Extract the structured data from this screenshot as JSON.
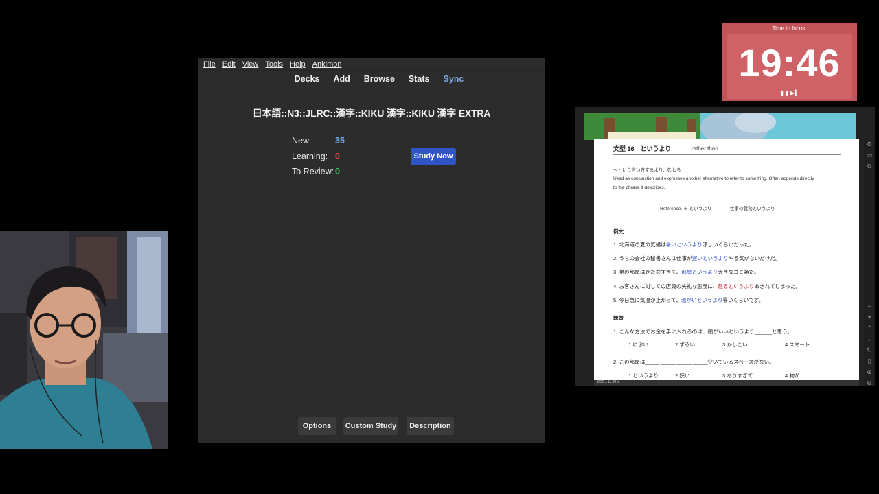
{
  "anki": {
    "menu": [
      "File",
      "Edit",
      "View",
      "Tools",
      "Help",
      "Ankimon"
    ],
    "toolbar": {
      "decks": "Decks",
      "add": "Add",
      "browse": "Browse",
      "stats": "Stats",
      "sync": "Sync"
    },
    "deck_title": "日本語::N3::JLRC::漢字::KIKU 漢字::KIKU 漢字 EXTRA",
    "stats": {
      "new_label": "New:",
      "new_value": "35",
      "learning_label": "Learning:",
      "learning_value": "0",
      "review_label": "To Review:",
      "review_value": "0"
    },
    "study_now": "Study Now",
    "buttons": {
      "options": "Options",
      "custom_study": "Custom Study",
      "description": "Description"
    },
    "colors": {
      "new": "#6fa8e8",
      "learning": "#e8484c",
      "review": "#3cc86a",
      "accent": "#2f54c6"
    }
  },
  "timer": {
    "label": "Time to focus!",
    "time": "19:46",
    "controls": "❚❚ ▶▍"
  },
  "pdf": {
    "title": "文型 16　というより",
    "subtitle": "rather than…",
    "definition": "～という言い方するより、むしろ",
    "desc1": "Used as conjunction and expresses another alternative to refer to something. Often appends directly",
    "desc2": "to the phrase it describes.",
    "reference": "Reference. ＋ というより　　　　仕事の義務というより",
    "examples_heading": "例文",
    "examples": [
      {
        "a": "1. 北海道の夏の気候は",
        "b": "暑いというより",
        "c": "涼しいぐらいだった。"
      },
      {
        "a": "2. うちの会社の秘書さんは仕事が",
        "b": "遅いというより",
        "c": "やる気がないだけだ。"
      },
      {
        "a": "3. 弟の部屋はきたなすぎて、",
        "b": "部屋というより",
        "c": "大きなゴミ箱だ。"
      },
      {
        "a": "4. お客さんに対しての店員の失礼な態度に、",
        "b": "怒るというより",
        "c": "あきれてしまった。"
      },
      {
        "a": "5. 今日急に気温が上がって、",
        "b": "温かいというより",
        "c": "暑いくらいです。"
      }
    ],
    "practice_heading": "練習",
    "q1": "1. こんな方法でお金を手に入れるのは、頭がいいというより______と思う。",
    "q1_options": [
      "1 にぶい",
      "2 ずるい",
      "3 かしこい",
      "4 スマート"
    ],
    "q2": "2. この部屋は_____ _____ _____ _____空いているスペースがない。",
    "q2_options": [
      "1 というより",
      "2 狭い",
      "3 ありすぎて",
      "4 物が"
    ],
    "zoom": "8.50 x 11.00 in",
    "tools": [
      "gear-icon",
      "doc-icon",
      "copy-icon",
      "layers-icon",
      "arrow-down-icon",
      "up-icon",
      "down-icon",
      "refresh-icon",
      "page-icon",
      "zoom-in-icon",
      "zoom-out-icon"
    ]
  }
}
